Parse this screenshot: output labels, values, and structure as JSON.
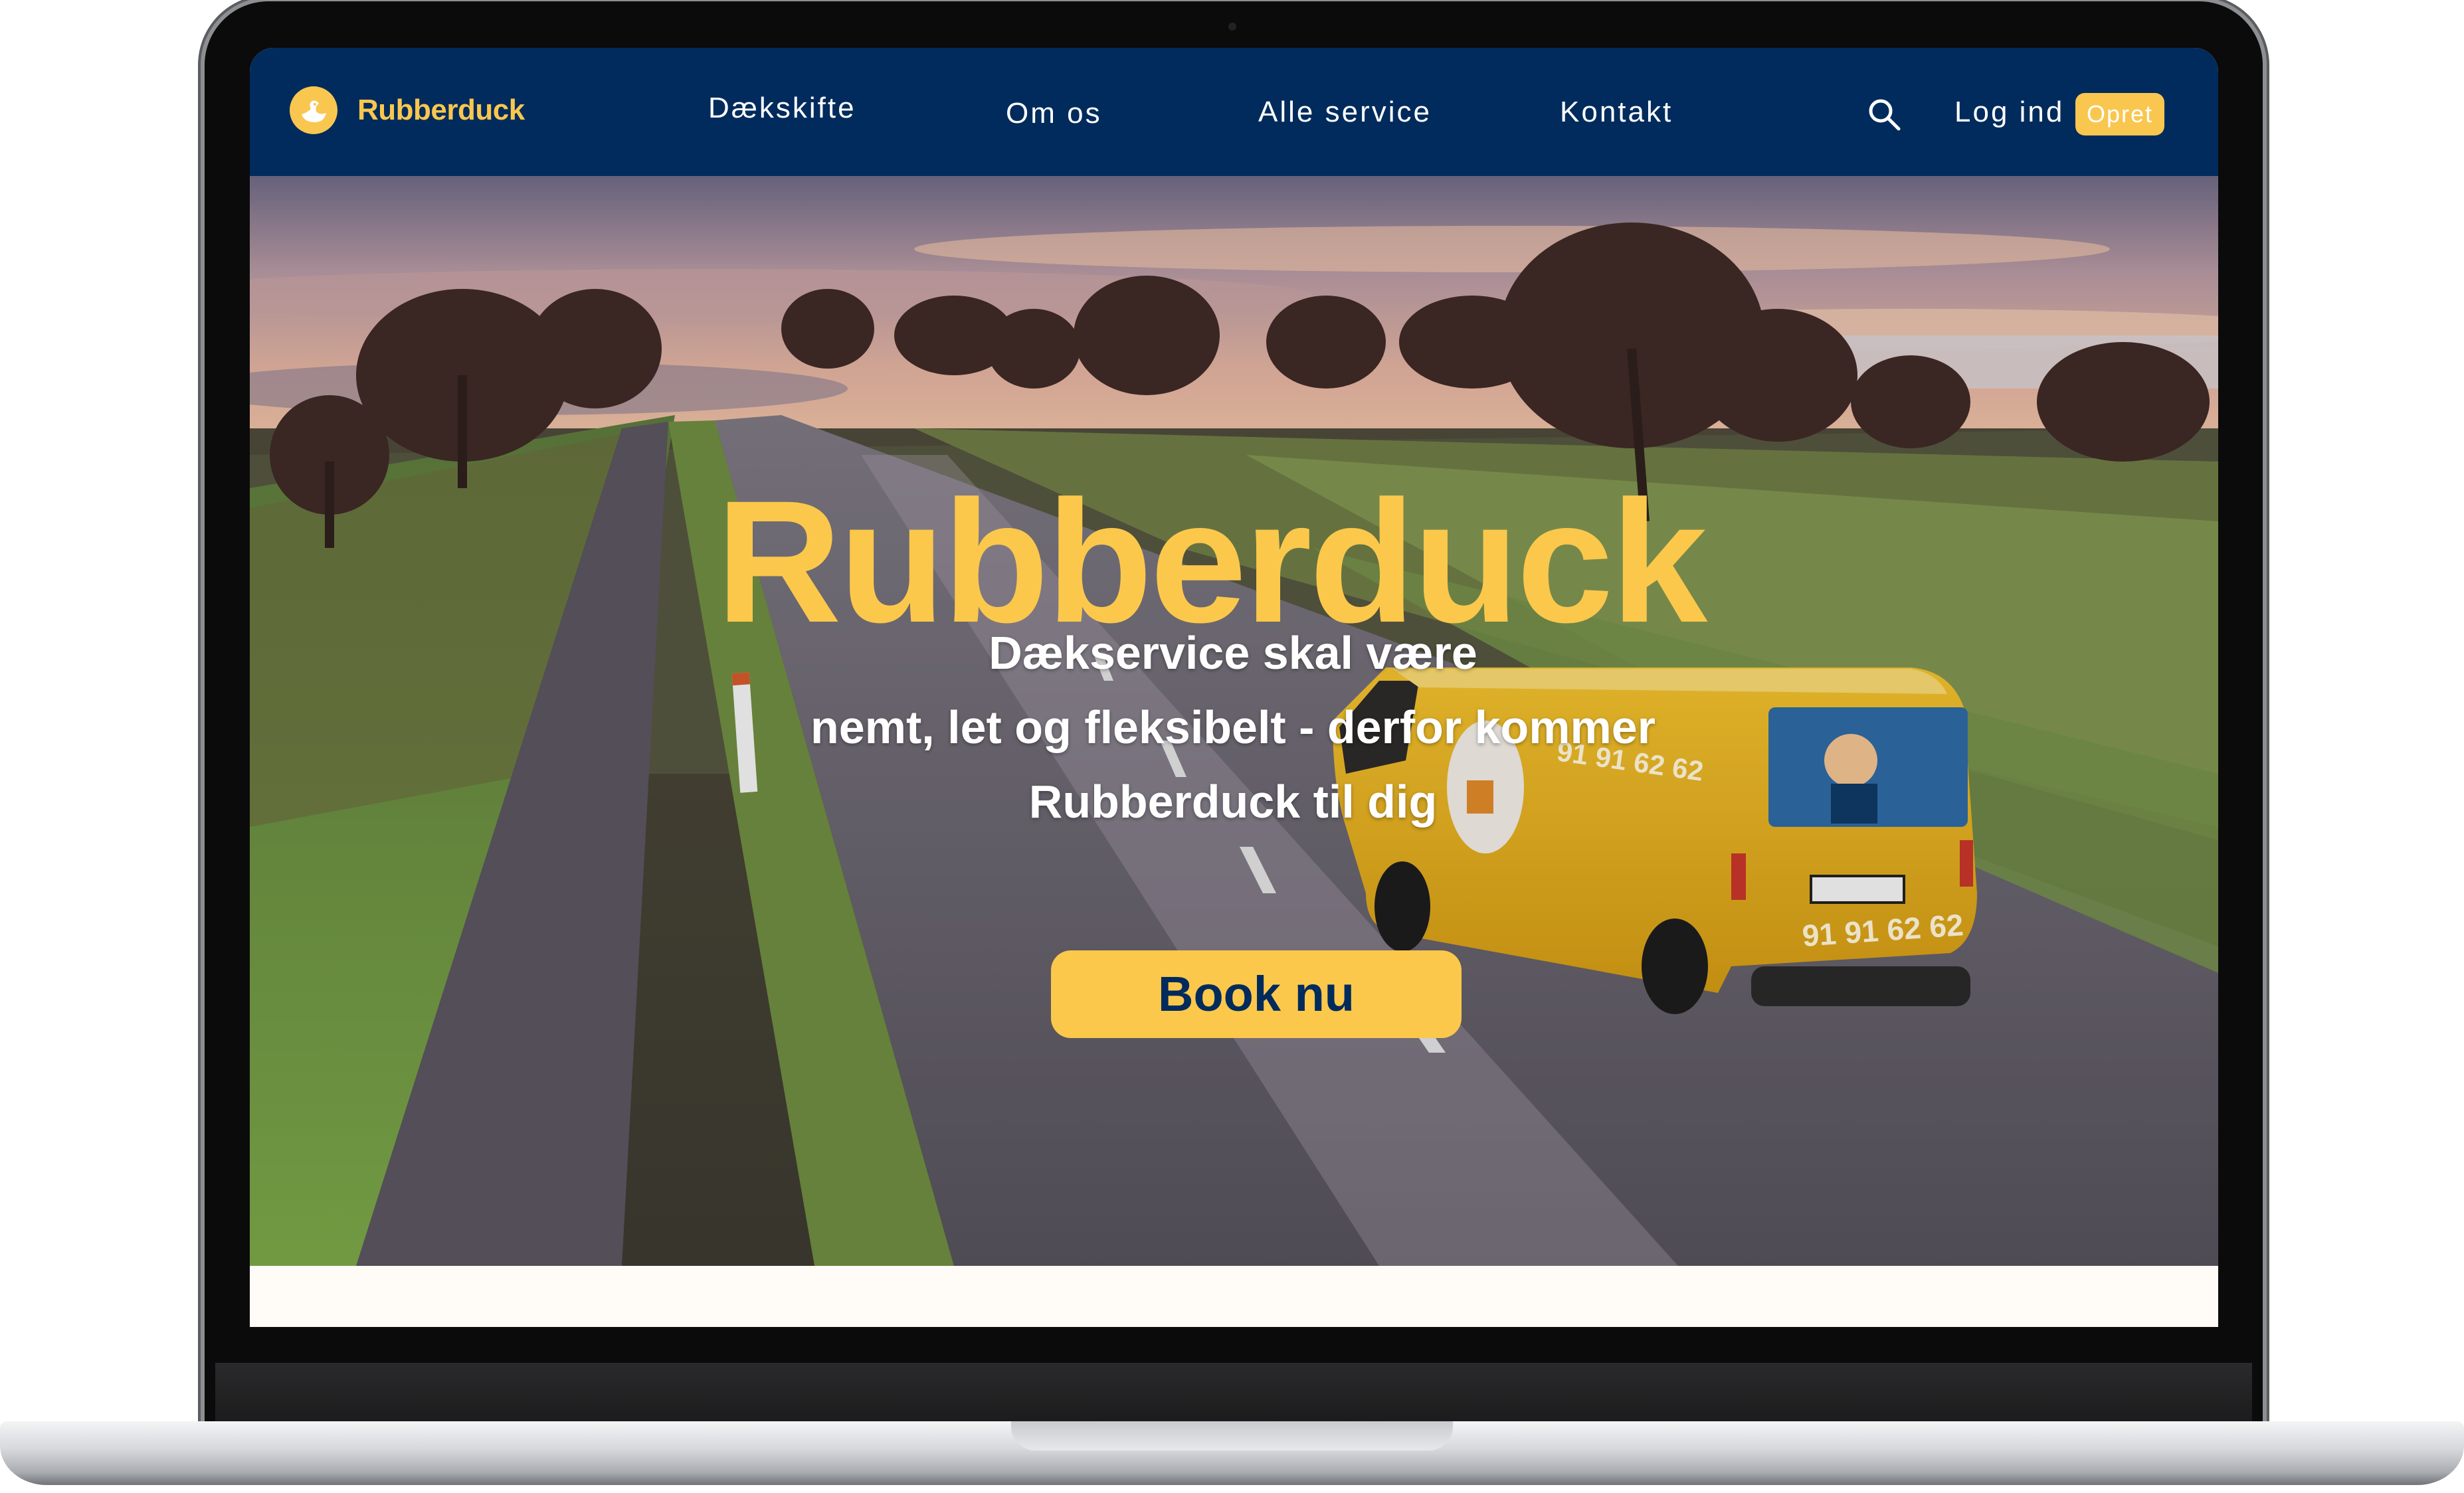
{
  "brand": {
    "name": "Rubberduck",
    "primary_color": "#002b5c",
    "accent_color": "#f9c74f"
  },
  "nav": {
    "links": [
      "Dækskifte",
      "Om os",
      "Alle service",
      "Kontakt"
    ],
    "search_icon": "search-icon",
    "login_label": "Log ind",
    "signup_label": "Opret"
  },
  "hero": {
    "title": "Rubberduck",
    "subtitle_lines": [
      "Dækservice skal være",
      "nemt, let og fleksibelt - derfor kommer",
      "Rubberduck til dig"
    ],
    "cta_label": "Book nu",
    "van_phone": "91 91 62 62"
  }
}
